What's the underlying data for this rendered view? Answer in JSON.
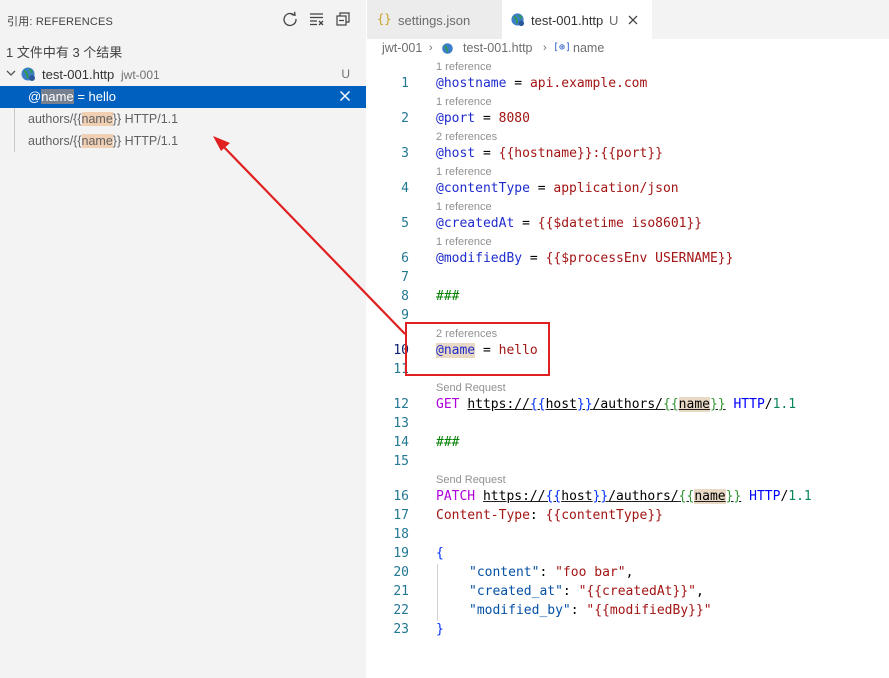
{
  "sidebar": {
    "title": "引用: REFERENCES",
    "header_icons": [
      "refresh-icon",
      "clear-all-icon",
      "collapse-all-icon"
    ],
    "summary": "1 文件中有 3 个结果",
    "file": {
      "name": "test-001.http",
      "folder": "jwt-001",
      "status": "U"
    },
    "references": [
      {
        "prefix": "@",
        "match": "name",
        "suffix": " = hello",
        "selected": true
      },
      {
        "prefix": "authors/{{",
        "match": "name",
        "suffix": "}} HTTP/1.1",
        "selected": false
      },
      {
        "prefix": "authors/{{",
        "match": "name",
        "suffix": "}} HTTP/1.1",
        "selected": false
      }
    ]
  },
  "tabs": [
    {
      "label": "settings.json",
      "icon": "json-braces-icon",
      "active": false
    },
    {
      "label": "test-001.http",
      "icon": "http-globe-icon",
      "status": "U",
      "active": true
    }
  ],
  "breadcrumb": {
    "folder": "jwt-001",
    "file": "test-001.http",
    "symbol": "name"
  },
  "editor": {
    "lines": [
      {
        "n": "1",
        "lens": "1 reference"
      },
      {
        "n": "2",
        "lens": "1 reference"
      },
      {
        "n": "3",
        "lens": "2 references"
      },
      {
        "n": "4",
        "lens": "1 reference"
      },
      {
        "n": "5",
        "lens": "1 reference"
      },
      {
        "n": "6",
        "lens": "1 reference"
      },
      {
        "n": "7"
      },
      {
        "n": "8"
      },
      {
        "n": "9"
      },
      {
        "n": "10",
        "lens": "2 references"
      },
      {
        "n": "11"
      },
      {
        "n": "12",
        "lens": "Send Request"
      },
      {
        "n": "13"
      },
      {
        "n": "14"
      },
      {
        "n": "15"
      },
      {
        "n": "16",
        "lens": "Send Request"
      },
      {
        "n": "17"
      },
      {
        "n": "18"
      },
      {
        "n": "19"
      },
      {
        "n": "20"
      },
      {
        "n": "21"
      },
      {
        "n": "22"
      },
      {
        "n": "23"
      }
    ],
    "code": {
      "l1": [
        "@hostname",
        " = ",
        "api.example.com"
      ],
      "l2": [
        "@port",
        " = ",
        "8080"
      ],
      "l3": [
        "@host",
        " = ",
        "{{",
        "hostname",
        "}}:{{",
        "port",
        "}}"
      ],
      "l4": [
        "@contentType",
        " = ",
        "application/json"
      ],
      "l5": [
        "@createdAt",
        " = ",
        "{{$datetime iso8601}}"
      ],
      "l6": [
        "@modifiedBy",
        " = ",
        "{{$processEnv USERNAME}}"
      ],
      "l8": "###",
      "l10": [
        "@name",
        " = ",
        "hello"
      ],
      "l12": [
        "GET",
        "https://",
        "{{",
        "host",
        "}}",
        "/authors/",
        "{{",
        "name",
        "}}",
        "HTTP",
        "/",
        "1.1"
      ],
      "l14": "###",
      "l16": [
        "PATCH",
        "https://",
        "{{",
        "host",
        "}}",
        "/authors/",
        "{{",
        "name",
        "}}",
        "HTTP",
        "/",
        "1.1"
      ],
      "l17": [
        "Content-Type",
        ": ",
        "{{contentType}}"
      ],
      "l19": "{",
      "l20": [
        "\"content\"",
        ": ",
        "\"foo bar\"",
        ","
      ],
      "l21": [
        "\"created_at\"",
        ": ",
        "\"{{createdAt}}\"",
        ","
      ],
      "l22": [
        "\"modified_by\"",
        ": ",
        "\"{{modifiedBy}}\""
      ],
      "l23": "}"
    }
  },
  "colors": {
    "selection": "#0060c0",
    "match_highlight": "#f0cfb3",
    "annotation": "#e02020",
    "line_number": "#237893"
  }
}
